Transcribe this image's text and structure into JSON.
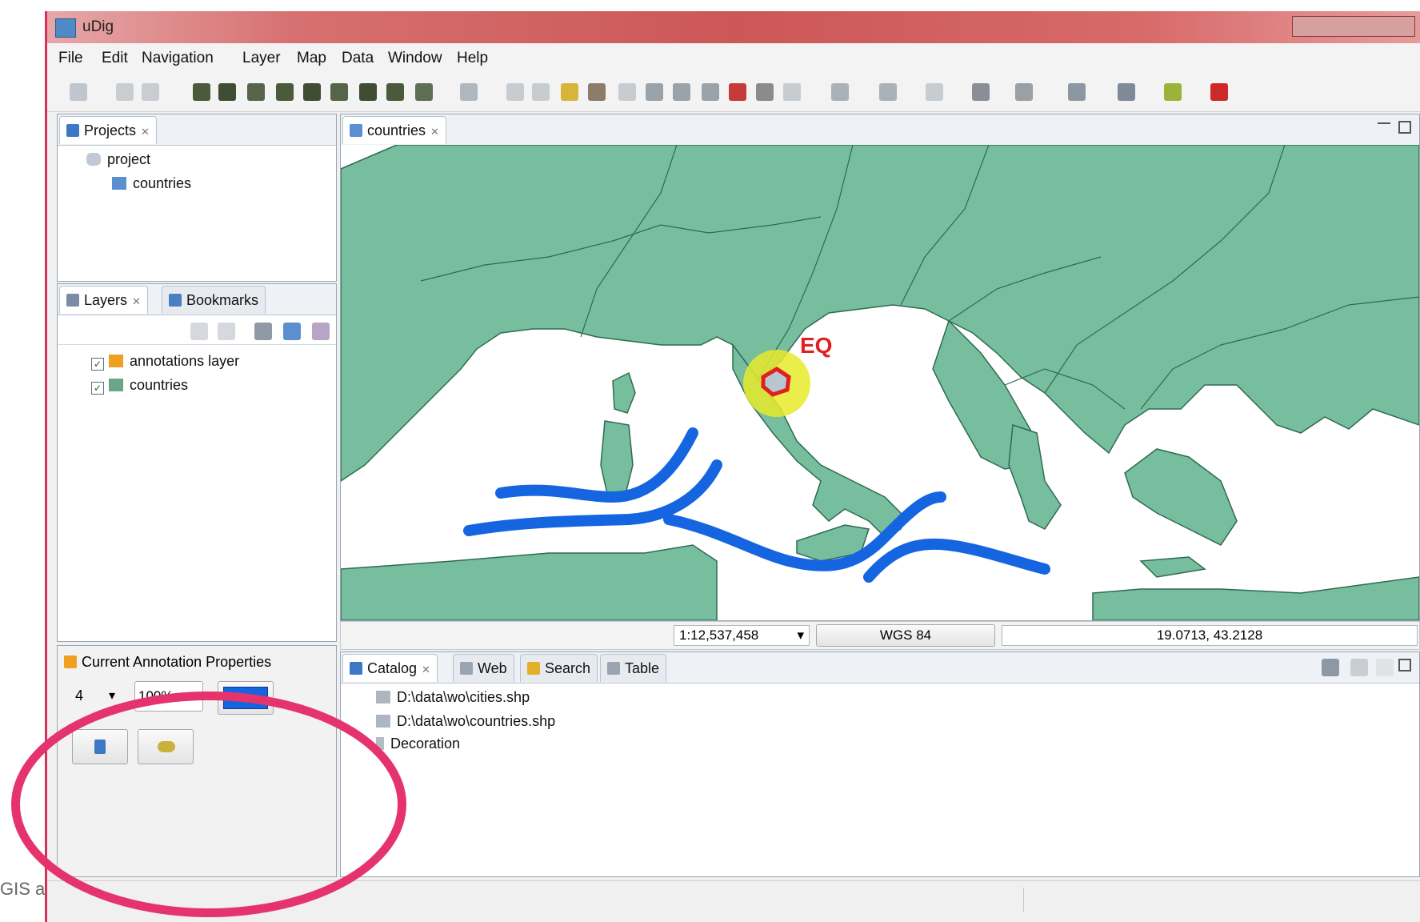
{
  "desktop": {
    "edge_text": "GIS a"
  },
  "window": {
    "title": "uDig"
  },
  "menu": [
    "File",
    "Edit",
    "Navigation",
    "Layer",
    "Map",
    "Data",
    "Window",
    "Help"
  ],
  "projects_panel": {
    "tab": "Projects",
    "items": [
      {
        "label": "project",
        "icon": "project-icon"
      },
      {
        "label": "countries",
        "icon": "map-icon"
      }
    ]
  },
  "layers_panel": {
    "tabs": [
      "Layers",
      "Bookmarks"
    ],
    "items": [
      {
        "label": "annotations layer",
        "checked": true,
        "icon": "pencil-layer-icon"
      },
      {
        "label": "countries",
        "checked": true,
        "icon": "polygon-layer-icon"
      }
    ]
  },
  "annotation_panel": {
    "title": "Current Annotation Properties",
    "stroke_width": "4",
    "opacity": "100%",
    "color": "#1565e0"
  },
  "map_editor": {
    "tab": "countries"
  },
  "statusbar": {
    "scale": "1:12,537,458",
    "crs": "WGS 84",
    "coords": "19.0713, 43.2128"
  },
  "bottom_panel": {
    "tabs": [
      "Catalog",
      "Web",
      "Search",
      "Table"
    ],
    "items": [
      {
        "label": "D:\\data\\wo\\cities.shp",
        "icon": "shapefile-icon"
      },
      {
        "label": "D:\\data\\wo\\countries.shp",
        "icon": "shapefile-icon"
      },
      {
        "label": "Decoration",
        "icon": "decoration-icon"
      }
    ]
  },
  "map_annotations": {
    "label": "EQ"
  },
  "colors": {
    "land": "#76be9e",
    "sea": "#ffffff",
    "annotation_blue": "#1565e0",
    "annotation_red": "#e02020",
    "highlight_yellow": "#e8ea2a",
    "ring": "#e5336e"
  }
}
